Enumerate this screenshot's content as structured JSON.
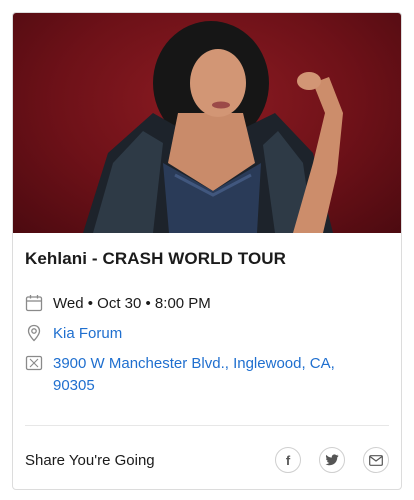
{
  "event": {
    "title": "Kehlani - CRASH WORLD TOUR",
    "date_time": "Wed • Oct 30 • 8:00 PM",
    "venue": "Kia Forum",
    "address": "3900 W Manchester Blvd., Inglewood, CA, 90305"
  },
  "share": {
    "label": "Share You're Going",
    "buttons": [
      {
        "name": "facebook",
        "glyph": "f"
      },
      {
        "name": "twitter",
        "glyph": "twitter-bird"
      },
      {
        "name": "email",
        "glyph": "envelope"
      }
    ]
  },
  "icons": {
    "date": "calendar-icon",
    "venue": "location-pin-icon",
    "address": "map-icon"
  },
  "colors": {
    "link": "#1f6fcf",
    "hero_bg": "#6d1118"
  }
}
